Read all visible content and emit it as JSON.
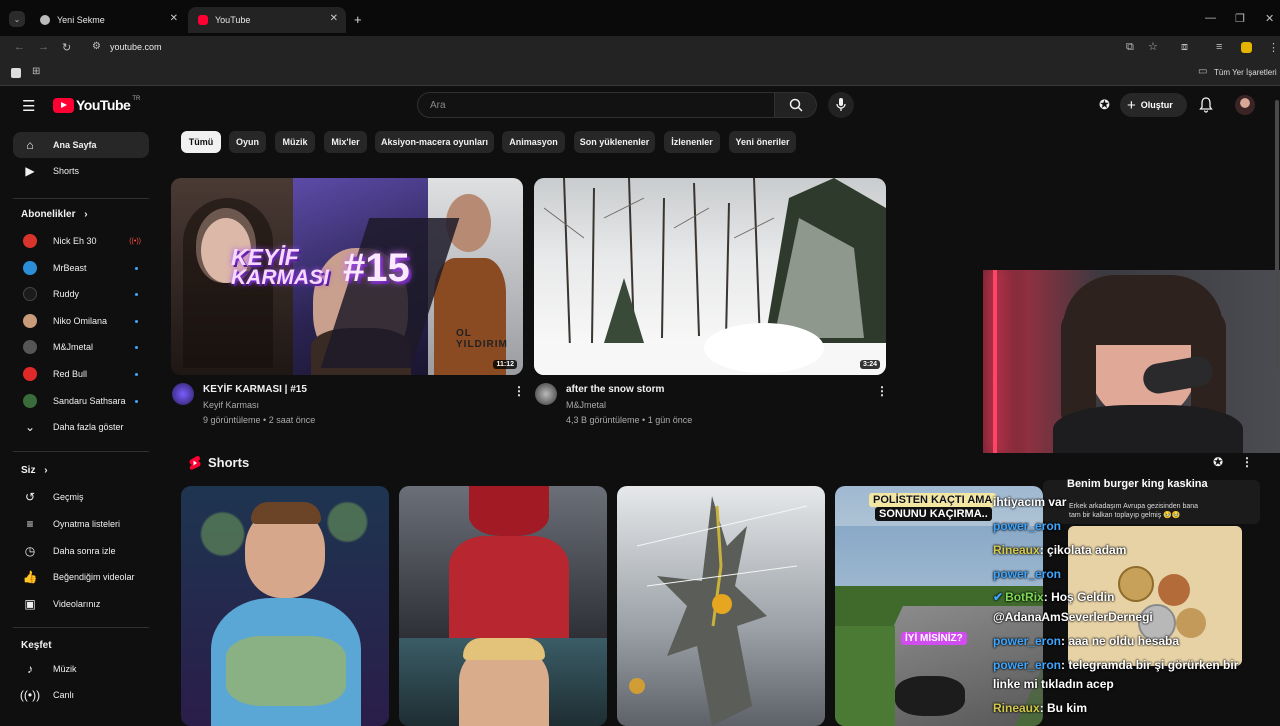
{
  "browser": {
    "tabs": [
      {
        "title": "Yeni Sekme",
        "active": false
      },
      {
        "title": "YouTube",
        "active": true
      }
    ],
    "new_tab_glyph": "+",
    "url": "youtube.com",
    "bookmarks_all_label": "Tüm Yer İşaretleri",
    "window_controls": [
      "minimize-icon",
      "restore-icon",
      "close-icon"
    ]
  },
  "header": {
    "logo_text": "YouTube",
    "country_code": "TR",
    "search_placeholder": "Ara",
    "create_label": "Oluştur"
  },
  "sidebar": {
    "top": [
      {
        "label": "Ana Sayfa",
        "icon": "home-icon",
        "active": true
      },
      {
        "label": "Shorts",
        "icon": "shorts-icon",
        "active": false
      }
    ],
    "subscriptions_heading": "Abonelikler",
    "subscriptions": [
      {
        "label": "Nick Eh 30",
        "color": "#d9342b",
        "indicator": "live"
      },
      {
        "label": "MrBeast",
        "color": "#2a8fd6",
        "indicator": "new"
      },
      {
        "label": "Ruddy",
        "color": "#1b1b1b",
        "indicator": "new"
      },
      {
        "label": "Niko Omilana",
        "color": "#c89b7b",
        "indicator": "new"
      },
      {
        "label": "M&Jmetal",
        "color": "#555555",
        "indicator": "new"
      },
      {
        "label": "Red Bull",
        "color": "#e02a2a",
        "indicator": "new"
      },
      {
        "label": "Sandaru Sathsara",
        "color": "#3a6b3a",
        "indicator": "new"
      }
    ],
    "show_more_label": "Daha fazla göster",
    "you_heading": "Siz",
    "you_items": [
      {
        "label": "Geçmiş",
        "icon": "history-icon"
      },
      {
        "label": "Oynatma listeleri",
        "icon": "playlists-icon"
      },
      {
        "label": "Daha sonra izle",
        "icon": "watch-later-icon"
      },
      {
        "label": "Beğendiğim videolar",
        "icon": "like-icon"
      },
      {
        "label": "Videolarınız",
        "icon": "your-videos-icon"
      }
    ],
    "explore_heading": "Keşfet",
    "explore_items": [
      {
        "label": "Müzik",
        "icon": "music-icon"
      },
      {
        "label": "Canlı",
        "icon": "live-icon"
      }
    ]
  },
  "chips": [
    "Tümü",
    "Oyun",
    "Müzik",
    "Mix'ler",
    "Aksiyon-macera oyunları",
    "Animasyon",
    "Son yüklenenler",
    "İzlenenler",
    "Yeni öneriler"
  ],
  "videos": [
    {
      "title": "KEYİF KARMASI | #15",
      "channel": "Keyif Karması",
      "meta": "9 görüntüleme • 2 saat önce",
      "duration": "11:12",
      "thumb_text_1": "KEYİF",
      "thumb_text_2": "KARMASI",
      "thumb_text_3": "#15",
      "thumb_text_4": "OL YILDIRIM"
    },
    {
      "title": "after the snow storm",
      "channel": "M&Jmetal",
      "meta": "4,3 B görüntüleme • 1 gün önce",
      "duration": "3:24"
    }
  ],
  "shorts_heading": "Shorts",
  "shorts": [
    {
      "description": "man with money"
    },
    {
      "description": "red suit hero"
    },
    {
      "description": "game character"
    },
    {
      "description": "road crash clip",
      "caption_1": "POLİSTEN KAÇTI AMA",
      "caption_2": "SONUNU KAÇIRMA..",
      "caption_3": "İYİ MİSİNİZ?"
    }
  ],
  "overlay_chat": [
    {
      "user": "",
      "text": "ihtiyacım var",
      "user_color": "#7ed957"
    },
    {
      "user": "power_eron",
      "text": "",
      "user_color": "#3ea6ff"
    },
    {
      "user": "Rineaux",
      "text": ": çikolata adam",
      "user_color": "#d4c94b"
    },
    {
      "user": "power_eron",
      "text": "",
      "user_color": "#3ea6ff"
    },
    {
      "user": "BotRix",
      "text": ": Hoş Geldin",
      "user_color": "#7ed957"
    },
    {
      "user": "",
      "text": "@AdanaAmSeverlerDernegi",
      "user_color": "#ffffff"
    },
    {
      "user": "power_eron",
      "text": ": aaa ne oldu hesaba",
      "user_color": "#3ea6ff"
    },
    {
      "user": "power_eron",
      "text": ": telegramda bir şi görürken bir",
      "user_color": "#3ea6ff"
    },
    {
      "user": "",
      "text": "linke mi tıkladın acep",
      "user_color": "#ffffff"
    },
    {
      "user": "Rineaux",
      "text": ": Bu kim",
      "user_color": "#d4c94b"
    }
  ],
  "overlay_popup": {
    "header": "Benim burger king kaskina",
    "body": "Erkek arkadaşım Avrupa gezisinden bana tam bir kalkan toplayıp gelmiş 🥹🥹"
  },
  "colors": {
    "accent_red": "#ff0033",
    "page_bg": "#0f0f0f",
    "chip_bg": "#272727",
    "link_blue": "#3ea6ff"
  }
}
